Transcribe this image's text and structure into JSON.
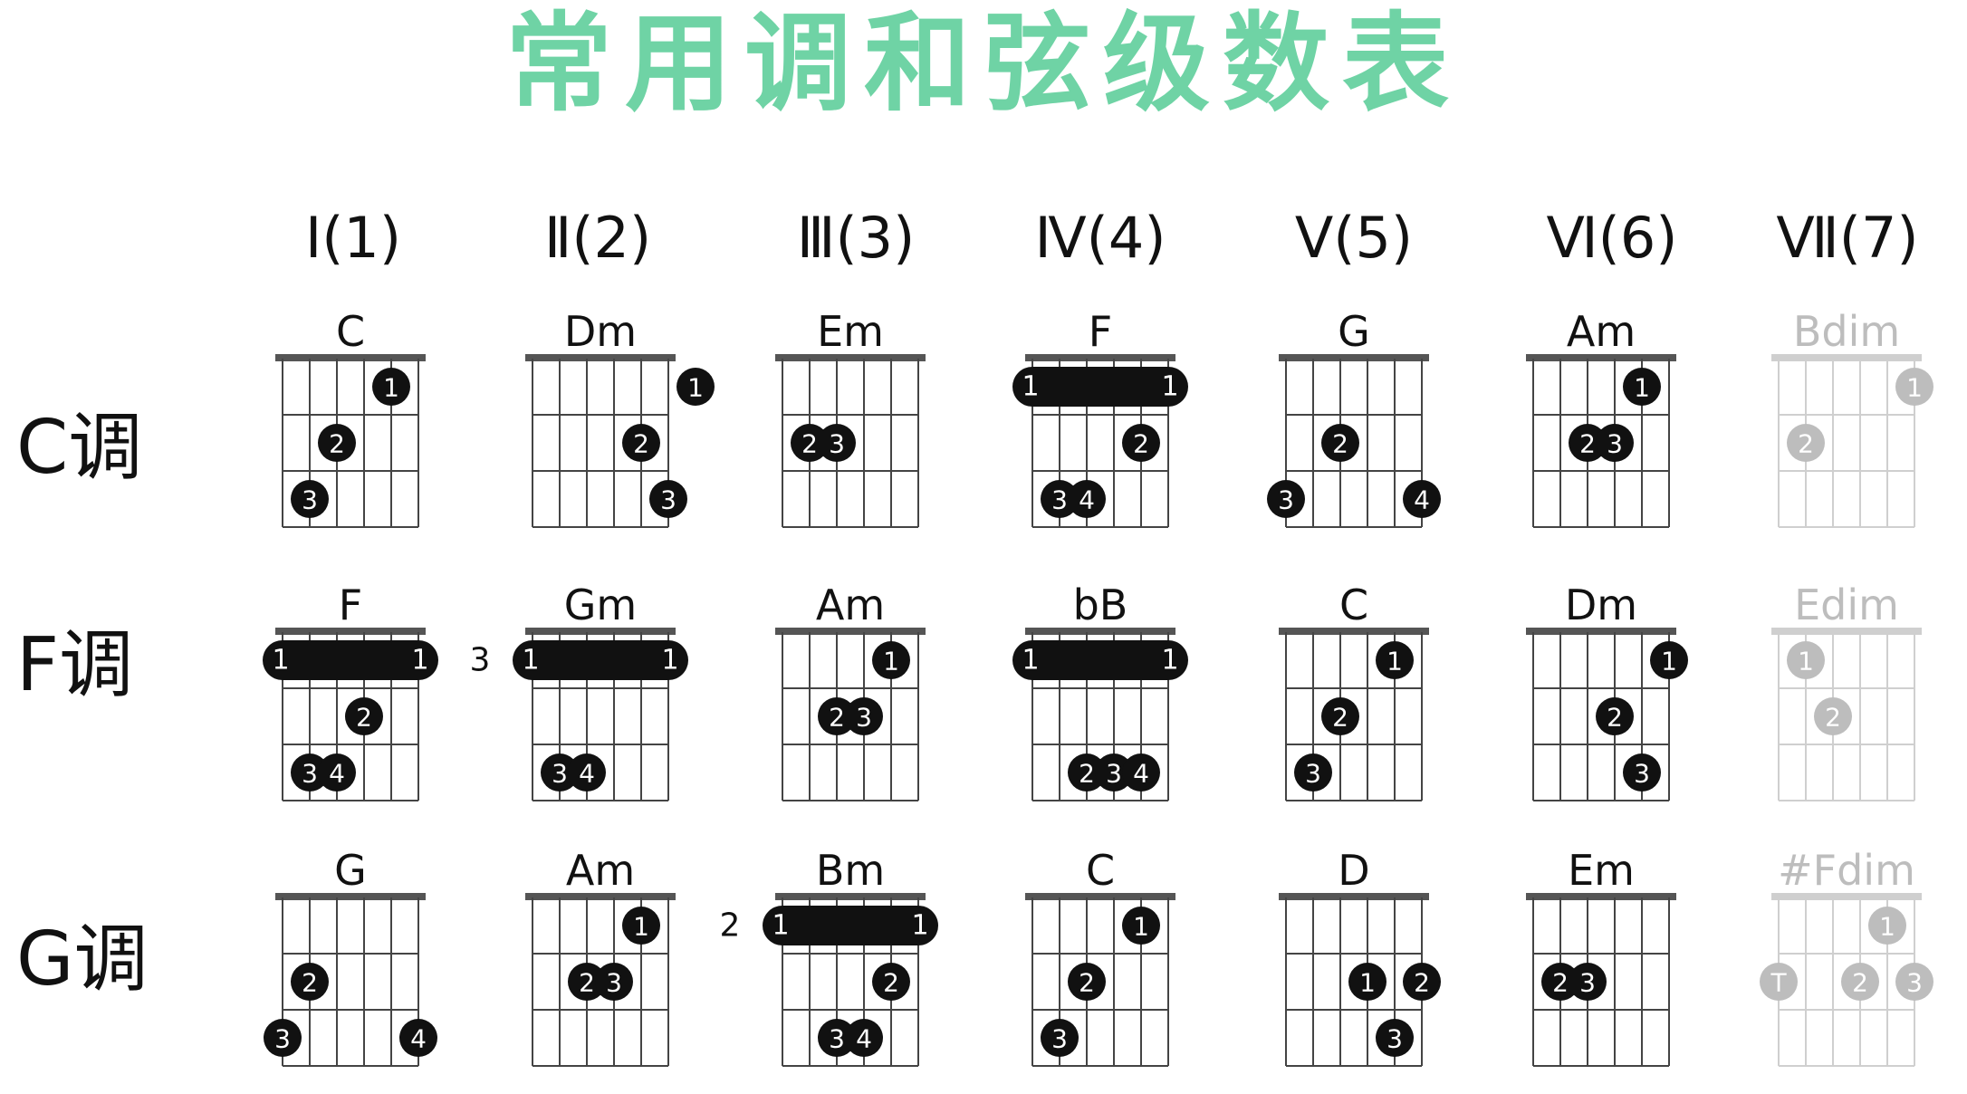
{
  "title": "常用调和弦级数表",
  "colors": {
    "title": "#6fd3a5",
    "ink": "#111111",
    "faded": "#bdbdbd"
  },
  "degrees": [
    "Ⅰ(1)",
    "Ⅱ(2)",
    "Ⅲ(3)",
    "Ⅳ(4)",
    "Ⅴ(5)",
    "Ⅵ(6)",
    "Ⅶ(7)"
  ],
  "keys": [
    {
      "label": "C调",
      "chords": [
        {
          "name": "C",
          "dots": [
            {
              "s": 4,
              "f": 1,
              "n": "1"
            },
            {
              "s": 2,
              "f": 2,
              "n": "2"
            },
            {
              "s": 1,
              "f": 3,
              "n": "3"
            }
          ]
        },
        {
          "name": "Dm",
          "dots": [
            {
              "s": 6,
              "f": 1,
              "n": "1"
            },
            {
              "s": 4,
              "f": 2,
              "n": "2"
            },
            {
              "s": 5,
              "f": 3,
              "n": "3"
            }
          ]
        },
        {
          "name": "Em",
          "dots": [
            {
              "s": 1,
              "f": 2,
              "n": "2"
            },
            {
              "s": 2,
              "f": 2,
              "n": "3"
            }
          ]
        },
        {
          "name": "F",
          "barre": {
            "n1": "1",
            "n2": "1"
          },
          "dots": [
            {
              "s": 4,
              "f": 2,
              "n": "2"
            },
            {
              "s": 1,
              "f": 3,
              "n": "3"
            },
            {
              "s": 2,
              "f": 3,
              "n": "4"
            }
          ]
        },
        {
          "name": "G",
          "dots": [
            {
              "s": 2,
              "f": 2,
              "n": "2"
            },
            {
              "s": 0,
              "f": 3,
              "n": "3"
            },
            {
              "s": 5,
              "f": 3,
              "n": "4"
            }
          ]
        },
        {
          "name": "Am",
          "dots": [
            {
              "s": 4,
              "f": 1,
              "n": "1"
            },
            {
              "s": 2,
              "f": 2,
              "n": "2"
            },
            {
              "s": 3,
              "f": 2,
              "n": "3"
            }
          ]
        },
        {
          "name": "Bdim",
          "faded": true,
          "dots": [
            {
              "s": 5,
              "f": 1,
              "n": "1"
            },
            {
              "s": 1,
              "f": 2,
              "n": "2"
            }
          ]
        }
      ]
    },
    {
      "label": "F调",
      "chords": [
        {
          "name": "F",
          "barre": {
            "n1": "1",
            "n2": "1"
          },
          "dots": [
            {
              "s": 3,
              "f": 2,
              "n": "2"
            },
            {
              "s": 1,
              "f": 3,
              "n": "3"
            },
            {
              "s": 2,
              "f": 3,
              "n": "4"
            }
          ]
        },
        {
          "name": "Gm",
          "fret": "3",
          "barre": {
            "n1": "1",
            "n2": "1"
          },
          "dots": [
            {
              "s": 1,
              "f": 3,
              "n": "3"
            },
            {
              "s": 2,
              "f": 3,
              "n": "4"
            }
          ]
        },
        {
          "name": "Am",
          "dots": [
            {
              "s": 4,
              "f": 1,
              "n": "1"
            },
            {
              "s": 2,
              "f": 2,
              "n": "2"
            },
            {
              "s": 3,
              "f": 2,
              "n": "3"
            }
          ]
        },
        {
          "name": "bB",
          "barre": {
            "n1": "1",
            "n2": "1"
          },
          "dots": [
            {
              "s": 2,
              "f": 3,
              "n": "2"
            },
            {
              "s": 3,
              "f": 3,
              "n": "3"
            },
            {
              "s": 4,
              "f": 3,
              "n": "4"
            }
          ]
        },
        {
          "name": "C",
          "dots": [
            {
              "s": 4,
              "f": 1,
              "n": "1"
            },
            {
              "s": 2,
              "f": 2,
              "n": "2"
            },
            {
              "s": 1,
              "f": 3,
              "n": "3"
            }
          ]
        },
        {
          "name": "Dm",
          "dots": [
            {
              "s": 5,
              "f": 1,
              "n": "1"
            },
            {
              "s": 3,
              "f": 2,
              "n": "2"
            },
            {
              "s": 4,
              "f": 3,
              "n": "3"
            }
          ]
        },
        {
          "name": "Edim",
          "faded": true,
          "dots": [
            {
              "s": 1,
              "f": 1,
              "n": "1"
            },
            {
              "s": 2,
              "f": 2,
              "n": "2"
            }
          ]
        }
      ]
    },
    {
      "label": "G调",
      "chords": [
        {
          "name": "G",
          "dots": [
            {
              "s": 1,
              "f": 2,
              "n": "2"
            },
            {
              "s": 0,
              "f": 3,
              "n": "3"
            },
            {
              "s": 5,
              "f": 3,
              "n": "4"
            }
          ]
        },
        {
          "name": "Am",
          "dots": [
            {
              "s": 4,
              "f": 1,
              "n": "1"
            },
            {
              "s": 2,
              "f": 2,
              "n": "2"
            },
            {
              "s": 3,
              "f": 2,
              "n": "3"
            }
          ]
        },
        {
          "name": "Bm",
          "fret": "2",
          "barre": {
            "n1": "1",
            "n2": "1"
          },
          "dots": [
            {
              "s": 4,
              "f": 2,
              "n": "2"
            },
            {
              "s": 2,
              "f": 3,
              "n": "3"
            },
            {
              "s": 3,
              "f": 3,
              "n": "4"
            }
          ]
        },
        {
          "name": "C",
          "dots": [
            {
              "s": 4,
              "f": 1,
              "n": "1"
            },
            {
              "s": 2,
              "f": 2,
              "n": "2"
            },
            {
              "s": 1,
              "f": 3,
              "n": "3"
            }
          ]
        },
        {
          "name": "D",
          "dots": [
            {
              "s": 3,
              "f": 2,
              "n": "1"
            },
            {
              "s": 5,
              "f": 2,
              "n": "2"
            },
            {
              "s": 4,
              "f": 3,
              "n": "3"
            }
          ]
        },
        {
          "name": "Em",
          "dots": [
            {
              "s": 1,
              "f": 2,
              "n": "2"
            },
            {
              "s": 2,
              "f": 2,
              "n": "3"
            }
          ]
        },
        {
          "name": "#Fdim",
          "faded": true,
          "dots": [
            {
              "s": 4,
              "f": 1,
              "n": "1"
            },
            {
              "s": 0,
              "f": 2,
              "n": "T"
            },
            {
              "s": 3,
              "f": 2,
              "n": "2"
            },
            {
              "s": 5,
              "f": 2,
              "n": "3"
            }
          ]
        }
      ]
    }
  ]
}
